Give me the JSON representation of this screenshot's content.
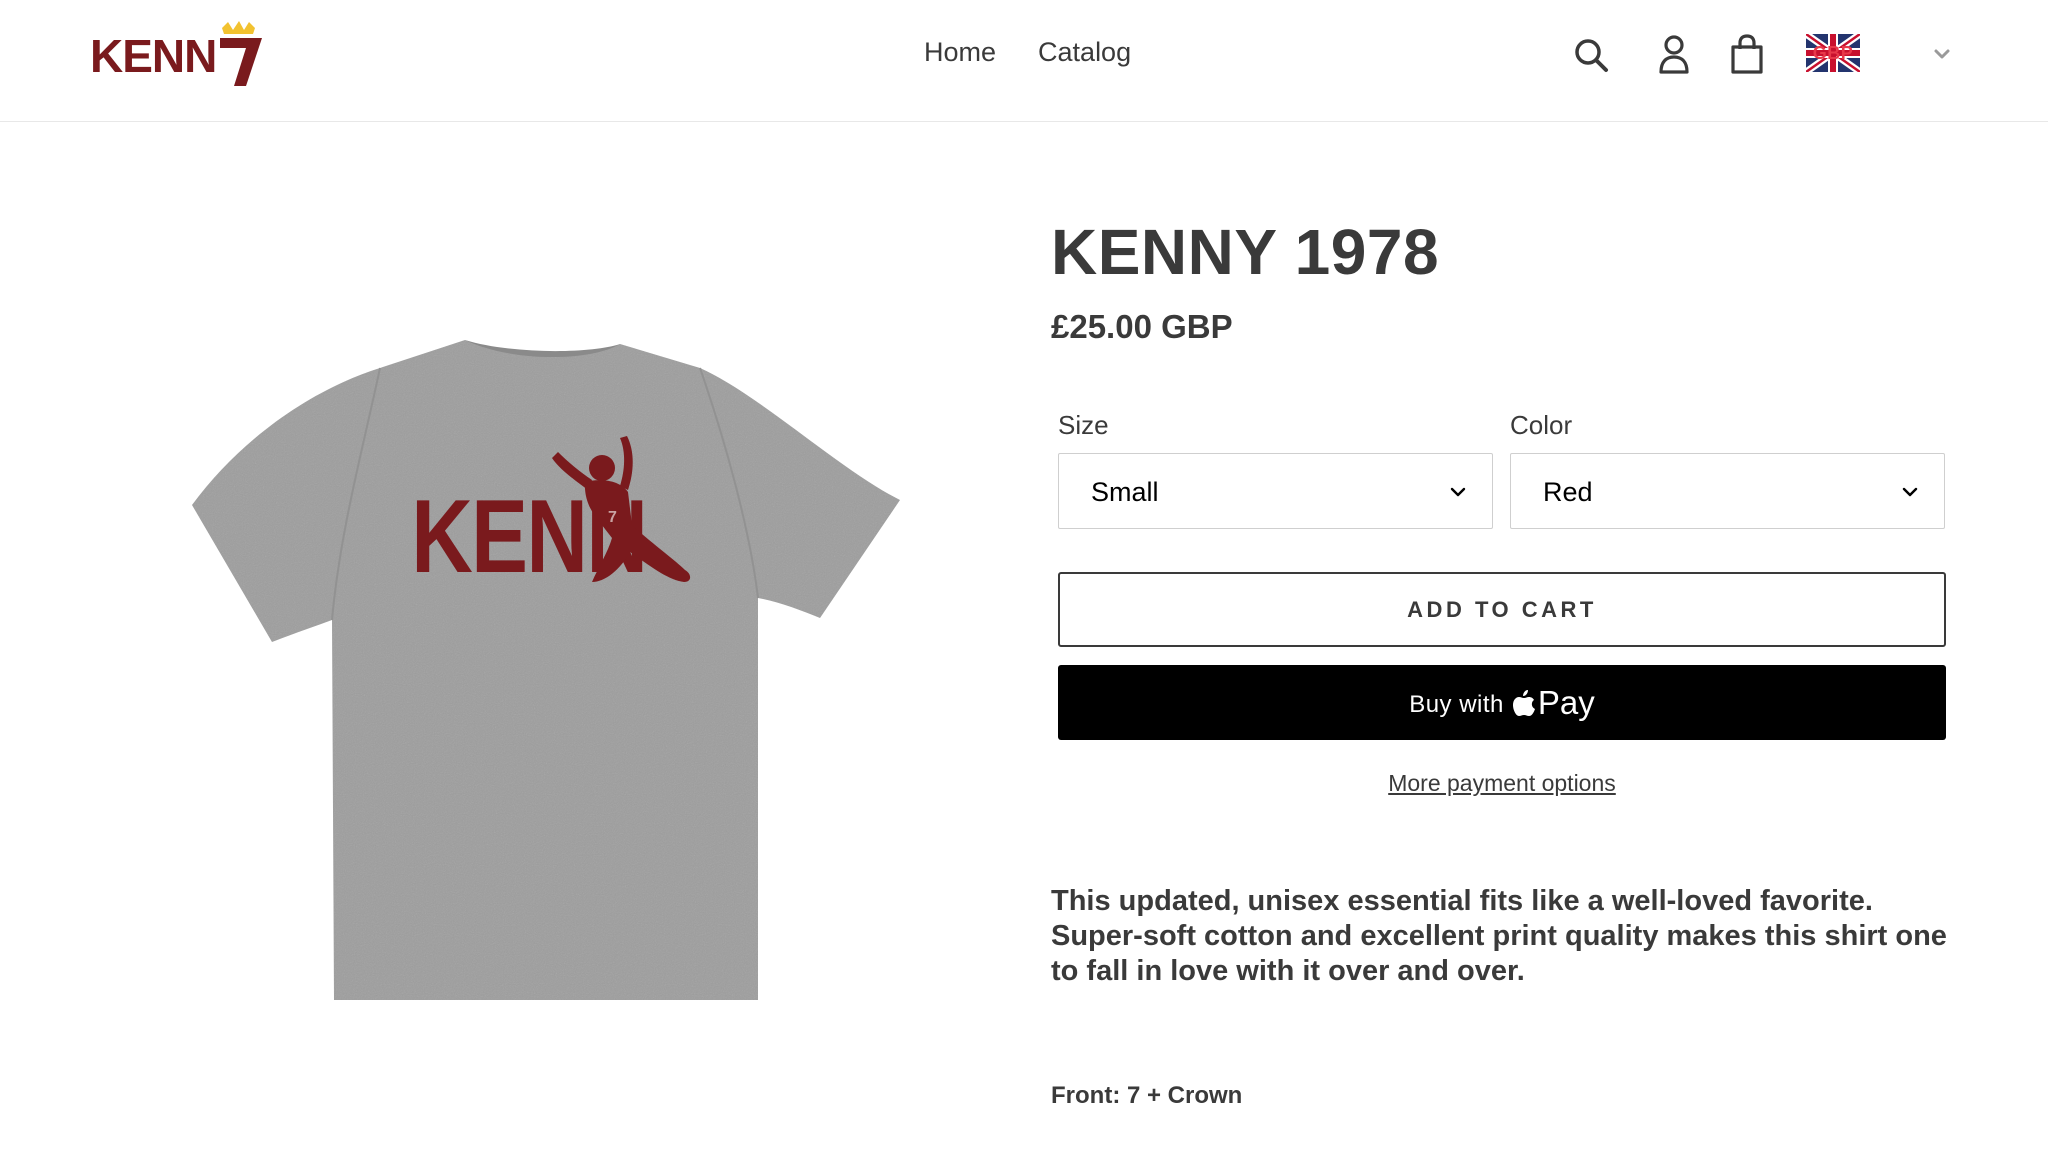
{
  "header": {
    "logo_text": "KENN7",
    "nav": [
      {
        "label": "Home"
      },
      {
        "label": "Catalog"
      }
    ],
    "icons": [
      "search-icon",
      "account-icon",
      "cart-icon"
    ],
    "currency_code": "GBP",
    "currency_flag": "uk-flag-icon"
  },
  "product": {
    "title": "KENNY 1978",
    "price": "£25.00 GBP",
    "image_print_text": "KENN",
    "options": {
      "size_label": "Size",
      "size_value": "Small",
      "color_label": "Color",
      "color_value": "Red"
    },
    "add_to_cart_label": "ADD TO CART",
    "buy_with_label": "Buy with",
    "pay_label": "Pay",
    "more_payment_label": "More payment options",
    "description": "This updated, unisex essential fits like a well-loved favorite. Super-soft cotton and excellent print quality makes this shirt one to fall in love with it over and over.",
    "front_note": "Front: 7 + Crown"
  },
  "colors": {
    "brand_maroon": "#7a1a1d",
    "crown_gold": "#f2c230",
    "shirt_gray": "#9e9e9e",
    "text_dark": "#3a3a3a",
    "buy_button_bg": "#000000"
  }
}
